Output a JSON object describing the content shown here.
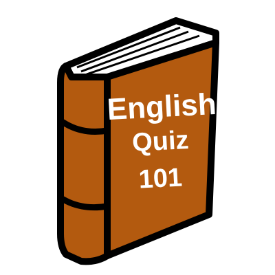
{
  "cover": {
    "line1": "English",
    "line2": "Quiz",
    "line3": "101"
  },
  "colors": {
    "cover": "#b35a0f",
    "outline": "#000000",
    "pages": "#ffffff",
    "text": "#ffffff"
  },
  "icon": "book-icon"
}
